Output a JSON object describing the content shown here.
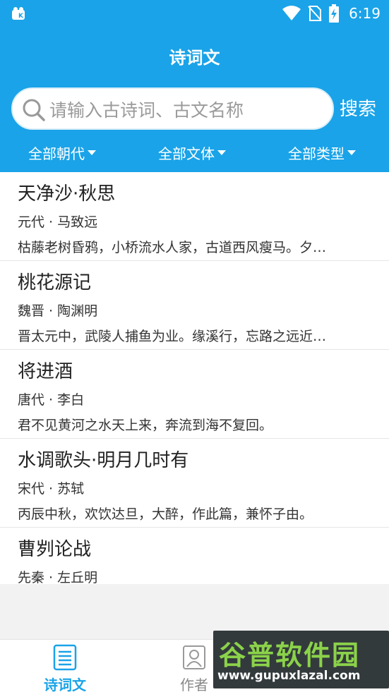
{
  "status_bar": {
    "time": "6:19"
  },
  "header": {
    "title": "诗词文"
  },
  "search": {
    "placeholder": "请输入古诗词、古文名称",
    "button_label": "搜索"
  },
  "filters": {
    "dynasty": "全部朝代",
    "genre": "全部文体",
    "category": "全部类型"
  },
  "works": [
    {
      "title": "天净沙·秋思",
      "meta": "元代 · 马致远",
      "excerpt": "枯藤老树昏鸦，小桥流水人家，古道西风瘦马。夕…"
    },
    {
      "title": "桃花源记",
      "meta": "魏晋 · 陶渊明",
      "excerpt": "晋太元中，武陵人捕鱼为业。缘溪行，忘路之远近…"
    },
    {
      "title": "将进酒",
      "meta": "唐代 · 李白",
      "excerpt": "君不见黄河之水天上来，奔流到海不复回。"
    },
    {
      "title": "水调歌头·明月几时有",
      "meta": "宋代 · 苏轼",
      "excerpt": "丙辰中秋，欢饮达旦，大醉，作此篇，兼怀子由。"
    },
    {
      "title": "曹刿论战",
      "meta": "先秦 · 左丘明",
      "excerpt": ""
    }
  ],
  "bottom_nav": {
    "poems_label": "诗词文",
    "authors_label": "作者"
  },
  "watermark": {
    "logo": "谷普软件园",
    "url": "www.gupuxlazal.com"
  },
  "colors": {
    "accent": "#1aa3e8",
    "background": "#f2f2f2"
  }
}
